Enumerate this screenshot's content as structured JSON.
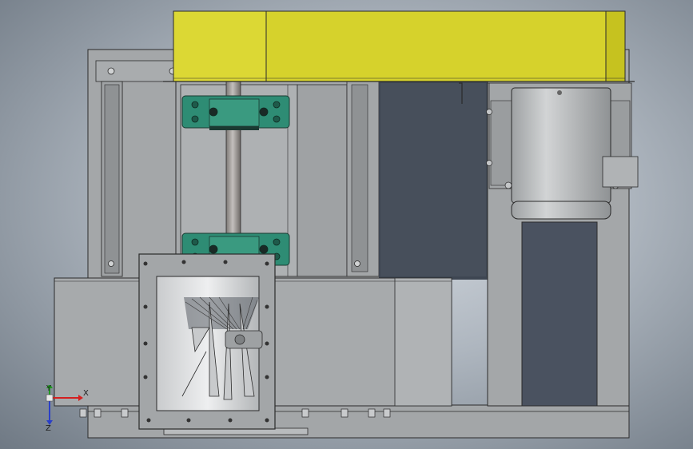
{
  "viewport": {
    "background_center": "#d8dde3",
    "background_edge": "#6f7984"
  },
  "colors": {
    "frame": "#a4a7a9",
    "frame_dark": "#8e9193",
    "outline": "#2b2b2b",
    "belt_guard": "#d6d22c",
    "belt_guard_dark": "#c6c21f",
    "bearing": "#2e8c74",
    "motor": "#b8bbbd",
    "shaft": "#9a9693"
  },
  "model": {
    "parts": [
      {
        "name": "belt-guard",
        "icon": "belt-guard-shape"
      },
      {
        "name": "pillow-block-bearing-upper",
        "icon": "bearing-shape"
      },
      {
        "name": "pillow-block-bearing-lower",
        "icon": "bearing-shape"
      },
      {
        "name": "drive-motor",
        "icon": "motor-shape"
      },
      {
        "name": "shaft",
        "icon": "shaft-shape"
      },
      {
        "name": "fan-housing",
        "icon": "housing-shape"
      },
      {
        "name": "impeller",
        "icon": "impeller-shape"
      }
    ]
  },
  "triad": {
    "x_label": "X",
    "y_label": "Y",
    "z_label": "Z",
    "x_color": "#d42020",
    "y_color": "#1f9a1f",
    "z_color": "#2a3fc8"
  }
}
